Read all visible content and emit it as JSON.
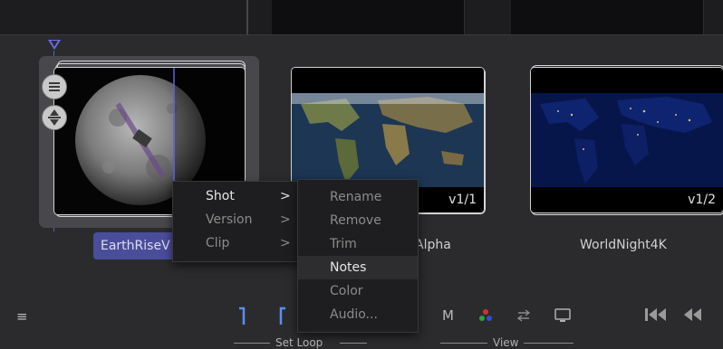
{
  "clips": [
    {
      "name": "EarthRiseV",
      "version": "",
      "selected": true
    },
    {
      "name": "Alpha",
      "version": "v1/1",
      "selected": false
    },
    {
      "name": "WorldNight4K",
      "version": "v1/2",
      "selected": false
    }
  ],
  "context_menu": {
    "items": [
      {
        "label": "Shot",
        "arrow": ">",
        "enabled": true
      },
      {
        "label": "Version",
        "arrow": ">",
        "enabled": false
      },
      {
        "label": "Clip",
        "arrow": ">",
        "enabled": false
      }
    ]
  },
  "submenu": {
    "items": [
      {
        "label": "Rename",
        "enabled": false
      },
      {
        "label": "Remove",
        "enabled": false
      },
      {
        "label": "Trim",
        "enabled": false
      },
      {
        "label": "Notes",
        "enabled": true,
        "highlighted": true
      },
      {
        "label": "Color",
        "enabled": false
      },
      {
        "label": "Audio...",
        "enabled": false
      }
    ]
  },
  "toolbar": {
    "menu_glyph": "≡",
    "monitor_label": "M",
    "set_loop_label": "Set Loop",
    "view_label": "View",
    "first_frame_glyph": "⏮",
    "rewind_glyph": "⏪"
  },
  "colors": {
    "accent": "#6b6ff0",
    "selected_label_bg": "#4a4e9a",
    "loop_marker": "#5a8ef0"
  }
}
